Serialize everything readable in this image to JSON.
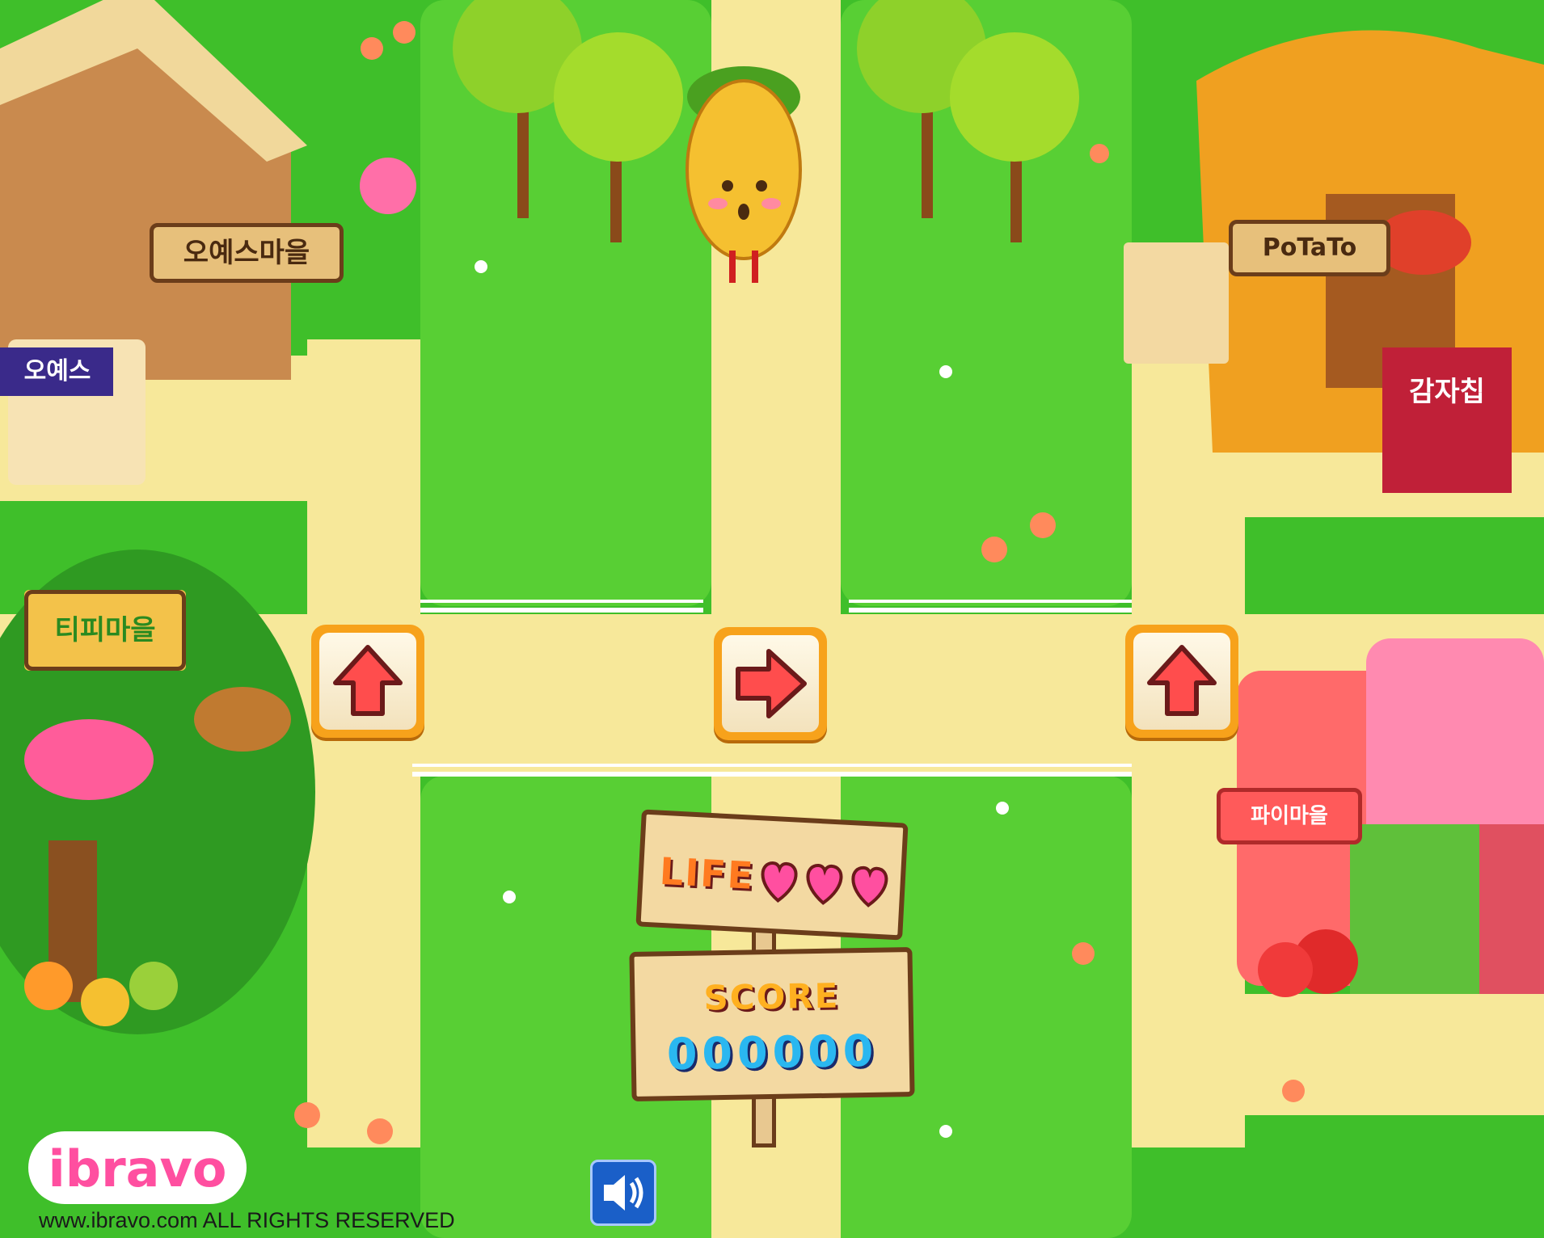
{
  "game": {
    "brand": "ibravo",
    "copyright": "www.ibravo.com ALL RIGHTS RESERVED",
    "life_label": "LIFE",
    "lives": 3,
    "score_label": "SCORE",
    "score": "000000"
  },
  "villages": {
    "oyes": {
      "sign": "오예스마을",
      "box_label": "오예스"
    },
    "tipi": {
      "sign": "티피마을"
    },
    "potato": {
      "sign": "PoTaTo",
      "bag_label": "감자칩"
    },
    "pie": {
      "sign": "파이마을"
    }
  },
  "controls": {
    "arrows": [
      {
        "name": "left-up",
        "direction": "up"
      },
      {
        "name": "center-right",
        "direction": "right"
      },
      {
        "name": "right-up",
        "direction": "up"
      }
    ],
    "sound": "speaker-icon"
  },
  "colors": {
    "grass": "#3fbf2a",
    "path": "#f7e89a",
    "sign_wood": "#f3d9a2",
    "heart": "#ff4fa0",
    "score_digit": "#2ab7f0",
    "button_orange": "#f7a21b",
    "arrow_red": "#ff4d4d"
  }
}
